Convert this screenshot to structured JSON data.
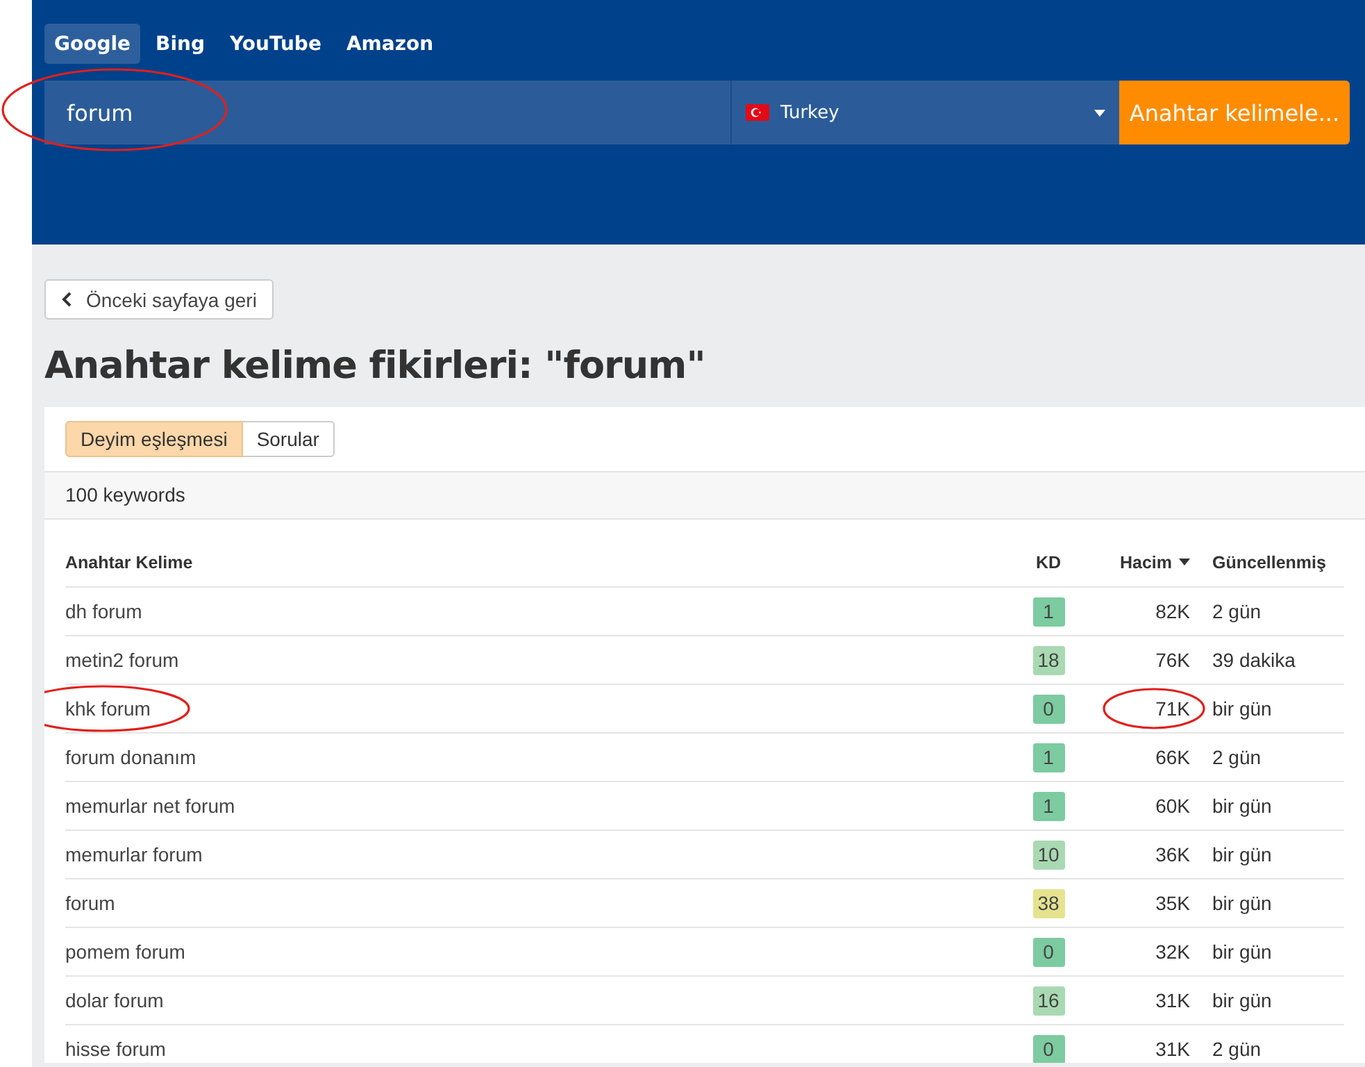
{
  "engines": [
    {
      "label": "Google",
      "selected": true
    },
    {
      "label": "Bing",
      "selected": false
    },
    {
      "label": "YouTube",
      "selected": false
    },
    {
      "label": "Amazon",
      "selected": false
    }
  ],
  "search": {
    "value": "forum",
    "circled": true
  },
  "country": {
    "label": "Turkey"
  },
  "submit_button": "Anahtar kelimele...",
  "back_button": "Önceki sayfaya geri",
  "heading": "Anahtar kelime fikirleri: \"forum\"",
  "tabs": [
    {
      "label": "Deyim eşleşmesi",
      "selected": true
    },
    {
      "label": "Sorular",
      "selected": false
    }
  ],
  "count": "100 keywords",
  "table": {
    "columns": [
      {
        "label": "Anahtar Kelime",
        "sorted": false
      },
      {
        "label": "KD",
        "sorted": false
      },
      {
        "label": "Hacim",
        "sorted": true
      },
      {
        "label": "Güncellenmiş",
        "sorted": false
      }
    ],
    "rows": [
      {
        "keyword": "dh forum",
        "kd": "1",
        "color": "#7dcba0",
        "volume": "82K",
        "updated": "2 gün",
        "circled": false
      },
      {
        "keyword": "metin2 forum",
        "kd": "18",
        "color": "#a9d9b2",
        "volume": "76K",
        "updated": "39 dakika",
        "circled": false
      },
      {
        "keyword": "khk forum",
        "kd": "0",
        "color": "#7dcba0",
        "volume": "71K",
        "updated": "bir gün",
        "circled": true
      },
      {
        "keyword": "forum donanım",
        "kd": "1",
        "color": "#7dcba0",
        "volume": "66K",
        "updated": "2 gün",
        "circled": false
      },
      {
        "keyword": "memurlar net forum",
        "kd": "1",
        "color": "#7dcba0",
        "volume": "60K",
        "updated": "bir gün",
        "circled": false
      },
      {
        "keyword": "memurlar forum",
        "kd": "10",
        "color": "#a9d9b2",
        "volume": "36K",
        "updated": "bir gün",
        "circled": false
      },
      {
        "keyword": "forum",
        "kd": "38",
        "color": "#e5e38f",
        "volume": "35K",
        "updated": "bir gün",
        "circled": false
      },
      {
        "keyword": "pomem forum",
        "kd": "0",
        "color": "#7dcba0",
        "volume": "32K",
        "updated": "bir gün",
        "circled": false
      },
      {
        "keyword": "dolar forum",
        "kd": "16",
        "color": "#a9d9b2",
        "volume": "31K",
        "updated": "bir gün",
        "circled": false
      },
      {
        "keyword": "hisse forum",
        "kd": "0",
        "color": "#7dcba0",
        "volume": "31K",
        "updated": "2 gün",
        "circled": false
      }
    ]
  }
}
